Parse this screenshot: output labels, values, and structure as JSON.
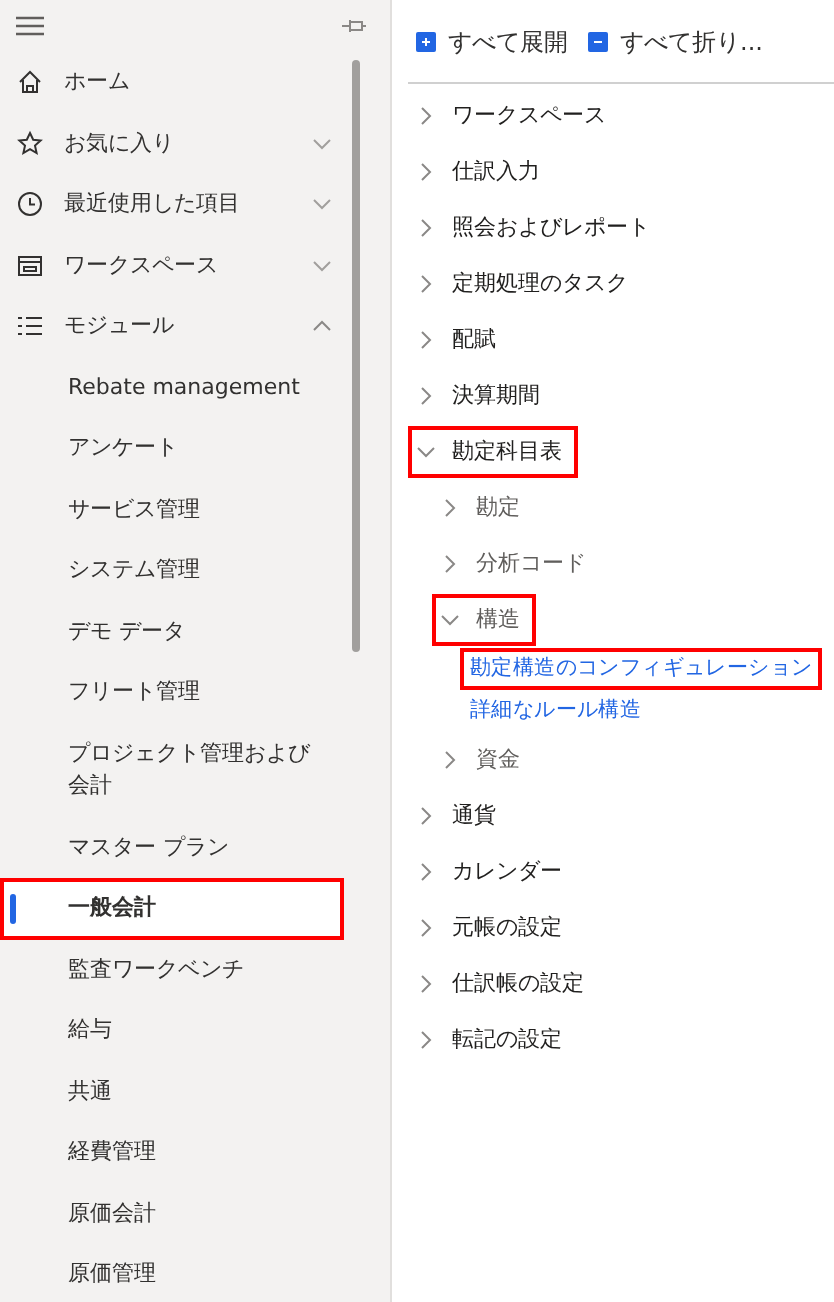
{
  "sidebar": {
    "items": [
      {
        "label": "ホーム"
      },
      {
        "label": "お気に入り",
        "expanded": false
      },
      {
        "label": "最近使用した項目",
        "expanded": false
      },
      {
        "label": "ワークスペース",
        "expanded": false
      },
      {
        "label": "モジュール",
        "expanded": true,
        "children": [
          {
            "label": "Rebate management",
            "selected": false,
            "highlighted": false
          },
          {
            "label": "アンケート",
            "selected": false,
            "highlighted": false
          },
          {
            "label": "サービス管理",
            "selected": false,
            "highlighted": false
          },
          {
            "label": "システム管理",
            "selected": false,
            "highlighted": false
          },
          {
            "label": "デモ データ",
            "selected": false,
            "highlighted": false
          },
          {
            "label": "フリート管理",
            "selected": false,
            "highlighted": false
          },
          {
            "label": "プロジェクト管理および会計",
            "selected": false,
            "highlighted": false
          },
          {
            "label": "マスター プラン",
            "selected": false,
            "highlighted": false
          },
          {
            "label": "一般会計",
            "selected": true,
            "highlighted": true
          },
          {
            "label": "監査ワークベンチ",
            "selected": false,
            "highlighted": false
          },
          {
            "label": "給与",
            "selected": false,
            "highlighted": false
          },
          {
            "label": "共通",
            "selected": false,
            "highlighted": false
          },
          {
            "label": "経費管理",
            "selected": false,
            "highlighted": false
          },
          {
            "label": "原価会計",
            "selected": false,
            "highlighted": false
          },
          {
            "label": "原価管理",
            "selected": false,
            "highlighted": false
          }
        ]
      }
    ]
  },
  "toolbar": [
    {
      "label": "すべて展開",
      "kind": "expand"
    },
    {
      "label": "すべて折り...",
      "kind": "collapse"
    }
  ],
  "tree": [
    {
      "label": "ワークスペース",
      "expanded": false,
      "highlighted": false
    },
    {
      "label": "仕訳入力",
      "expanded": false,
      "highlighted": false
    },
    {
      "label": "照会およびレポート",
      "expanded": false,
      "highlighted": false
    },
    {
      "label": "定期処理のタスク",
      "expanded": false,
      "highlighted": false
    },
    {
      "label": "配賦",
      "expanded": false,
      "highlighted": false
    },
    {
      "label": "決算期間",
      "expanded": false,
      "highlighted": false
    },
    {
      "label": "勘定科目表",
      "expanded": true,
      "highlighted": true,
      "children": [
        {
          "label": "勘定",
          "expanded": false,
          "highlighted": false
        },
        {
          "label": "分析コード",
          "expanded": false,
          "highlighted": false
        },
        {
          "label": "構造",
          "expanded": true,
          "highlighted": true,
          "children": [
            {
              "label": "勘定構造のコンフィギュレーション",
              "kind": "link",
              "highlighted": true
            },
            {
              "label": "詳細なルール構造",
              "kind": "link",
              "highlighted": false
            }
          ]
        },
        {
          "label": "資金",
          "expanded": false,
          "highlighted": false
        }
      ]
    },
    {
      "label": "通貨",
      "expanded": false,
      "highlighted": false
    },
    {
      "label": "カレンダー",
      "expanded": false,
      "highlighted": false
    },
    {
      "label": "元帳の設定",
      "expanded": false,
      "highlighted": false
    },
    {
      "label": "仕訳帳の設定",
      "expanded": false,
      "highlighted": false
    },
    {
      "label": "転記の設定",
      "expanded": false,
      "highlighted": false
    }
  ]
}
